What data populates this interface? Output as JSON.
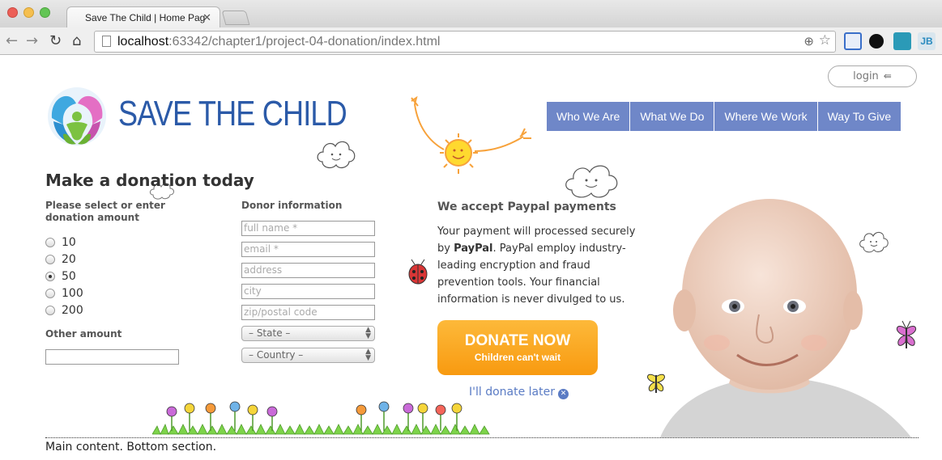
{
  "browser": {
    "tab_title": "Save The Child | Home Pag",
    "tab_close": "✕",
    "url_host": "localhost",
    "url_path": ":63342/chapter1/project-04-donation/index.html",
    "ext_jb": "JB"
  },
  "header": {
    "login_label": "login",
    "logo_text": "SAVE THE CHILD",
    "nav": [
      "Who We Are",
      "What We Do",
      "Where We Work",
      "Way To Give"
    ]
  },
  "donation": {
    "heading": "Make a donation today",
    "amount_label": "Please select or enter donation amount",
    "amounts": [
      "10",
      "20",
      "50",
      "100",
      "200"
    ],
    "selected_amount": "50",
    "other_label": "Other amount",
    "donor_label": "Donor information",
    "donor_fields": {
      "full_name": "full name *",
      "email": "email *",
      "address": "address",
      "city": "city",
      "zip": "zip/postal code"
    },
    "state_select": "– State –",
    "country_select": "– Country –"
  },
  "paypal": {
    "title": "We accept Paypal payments",
    "text_before": "Your payment will processed securely by ",
    "text_bold": "PayPal",
    "text_after": ". PayPal employ industry-leading encryption and fraud prevention tools. Your financial information is never divulged to us.",
    "donate_main": "DONATE NOW",
    "donate_sub": "Children can't wait",
    "later": "I'll donate later"
  },
  "footer": {
    "bottom_text": "Main content. Bottom section."
  },
  "colors": {
    "nav_bg": "#6f87c8",
    "logo_blue": "#2b5aa8",
    "donate_orange": "#f89a10",
    "link_blue": "#5a7bc4"
  }
}
